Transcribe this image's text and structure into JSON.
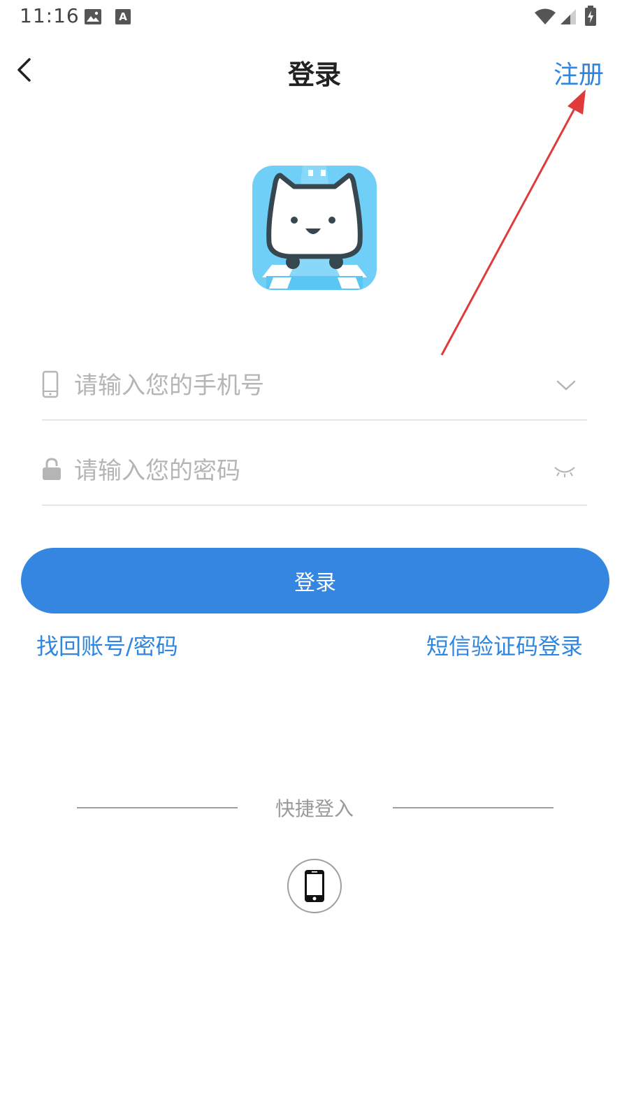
{
  "status_bar": {
    "time": "11:16",
    "icons": [
      "image-icon",
      "a-text-icon",
      "wifi-icon",
      "signal-icon",
      "battery-charging-icon"
    ]
  },
  "nav": {
    "back_icon": "chevron-left-icon",
    "title": "登录",
    "register_label": "注册"
  },
  "logo": {
    "name": "app-logo-cat-icon",
    "bg_color": "#6fcff7"
  },
  "form": {
    "phone": {
      "placeholder": "请输入您的手机号",
      "value": "",
      "left_icon": "phone-icon",
      "right_icon": "chevron-down-icon"
    },
    "password": {
      "placeholder": "请输入您的密码",
      "value": "",
      "left_icon": "lock-icon",
      "right_icon": "eye-closed-icon"
    }
  },
  "login_button": {
    "label": "登录",
    "color": "#3586e0"
  },
  "links": {
    "recover": "找回账号/密码",
    "sms_login": "短信验证码登录",
    "color": "#2f86e0"
  },
  "quick_login": {
    "label": "快捷登入",
    "options": [
      {
        "icon": "smartphone-icon"
      }
    ]
  },
  "annotation": {
    "arrow_color": "#e03a3a"
  }
}
